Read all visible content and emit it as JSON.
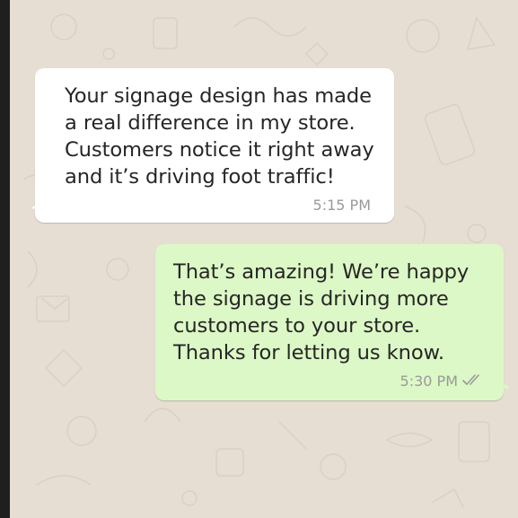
{
  "conversation": {
    "messages": [
      {
        "direction": "incoming",
        "text": "Your signage design has made\na real difference in my store.\nCustomers notice it right away\nand it’s driving foot traffic!",
        "time": "5:15 PM"
      },
      {
        "direction": "outgoing",
        "text": "That’s amazing! We’re happy\nthe signage is driving more\ncustomers to your store.\nThanks for letting us know.",
        "time": "5:30 PM",
        "status_icon": "double-check-icon"
      }
    ]
  },
  "colors": {
    "chat_background": "#e6ded3",
    "incoming_bubble": "#ffffff",
    "outgoing_bubble": "#dcf8c6",
    "meta_text": "#9a9a9a",
    "frame_border": "#1f1f1f"
  }
}
